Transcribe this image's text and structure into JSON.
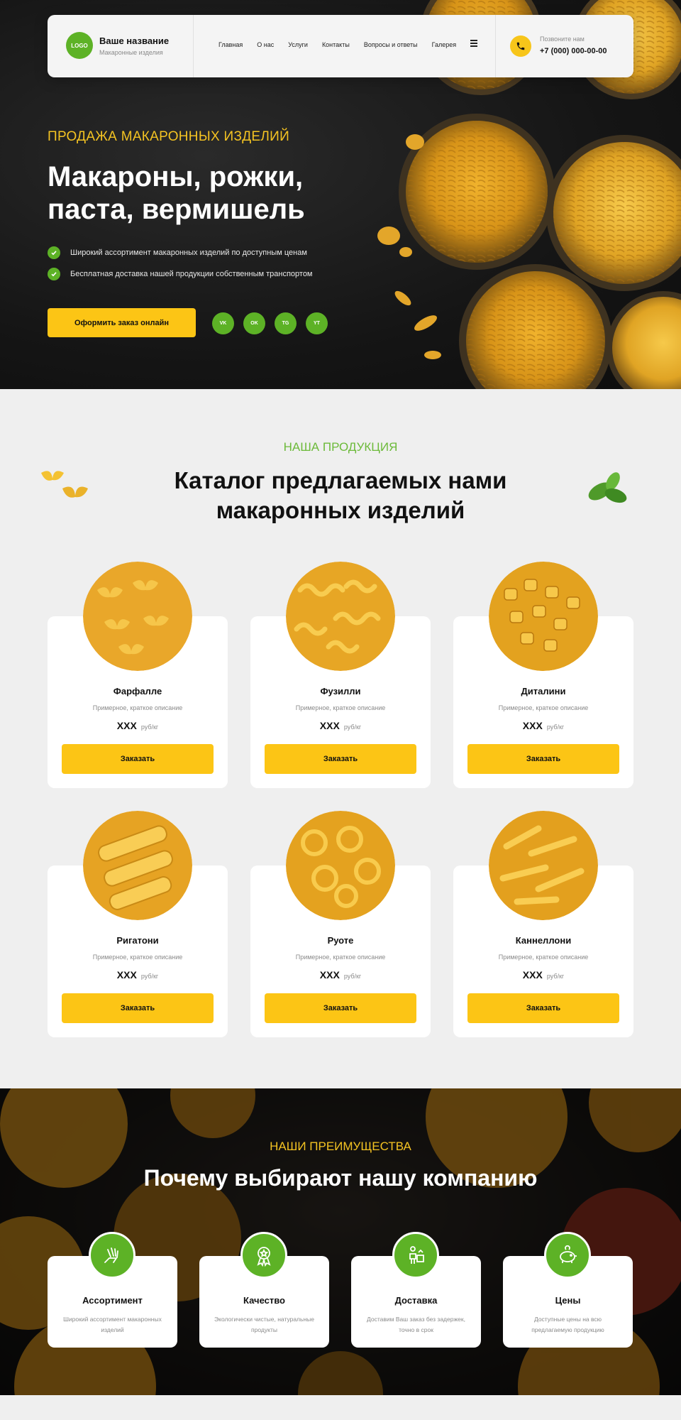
{
  "header": {
    "logo": "LOGO",
    "brand_name": "Ваше название",
    "brand_sub": "Макаронные изделия",
    "nav": [
      "Главная",
      "О нас",
      "Услуги",
      "Контакты",
      "Вопросы и ответы",
      "Галерея"
    ],
    "call_label": "Позвоните нам",
    "phone": "+7 (000) 000-00-00"
  },
  "hero": {
    "kicker": "ПРОДАЖА МАКАРОННЫХ ИЗДЕЛИЙ",
    "title_line1": "Макароны, рожки,",
    "title_line2": "паста, вермишель",
    "bullets": [
      "Широкий ассортимент макаронных изделий по доступным ценам",
      "Бесплатная доставка нашей продукции собственным транспортом"
    ],
    "order_button": "Оформить заказ онлайн",
    "socials": [
      "VK",
      "OK",
      "TG",
      "YT"
    ]
  },
  "catalog": {
    "kicker": "НАША ПРОДУКЦИЯ",
    "title_line1": "Каталог предлагаемых нами",
    "title_line2": "макаронных изделий",
    "products": [
      {
        "name": "Фарфалле",
        "desc": "Примерное, краткое описание",
        "price": "XXX",
        "unit": "руб/кг",
        "button": "Заказать"
      },
      {
        "name": "Фузилли",
        "desc": "Примерное, краткое описание",
        "price": "XXX",
        "unit": "руб/кг",
        "button": "Заказать"
      },
      {
        "name": "Диталини",
        "desc": "Примерное, краткое описание",
        "price": "XXX",
        "unit": "руб/кг",
        "button": "Заказать"
      },
      {
        "name": "Ригатони",
        "desc": "Примерное, краткое описание",
        "price": "XXX",
        "unit": "руб/кг",
        "button": "Заказать"
      },
      {
        "name": "Руоте",
        "desc": "Примерное, краткое описание",
        "price": "XXX",
        "unit": "руб/кг",
        "button": "Заказать"
      },
      {
        "name": "Каннеллони",
        "desc": "Примерное, краткое описание",
        "price": "XXX",
        "unit": "руб/кг",
        "button": "Заказать"
      }
    ]
  },
  "advantages": {
    "kicker": "НАШИ ПРЕИМУЩЕСТВА",
    "title": "Почему выбирают нашу компанию",
    "items": [
      {
        "name": "Ассортимент",
        "desc": "Широкий ассортимент макаронных изделий",
        "icon": "hands-icon"
      },
      {
        "name": "Качество",
        "desc": "Экологически чистые, натуральные продукты",
        "icon": "medal-icon"
      },
      {
        "name": "Доставка",
        "desc": "Доставим Ваш заказ без задержек, точно в срок",
        "icon": "courier-icon"
      },
      {
        "name": "Цены",
        "desc": "Доступные цены на всю предлагаемую продукцию",
        "icon": "piggy-bank-icon"
      }
    ]
  },
  "colors": {
    "accent_yellow": "#fcc515",
    "accent_green": "#5db226",
    "kicker_gold": "#f4c322",
    "dark_bg": "#151515"
  }
}
